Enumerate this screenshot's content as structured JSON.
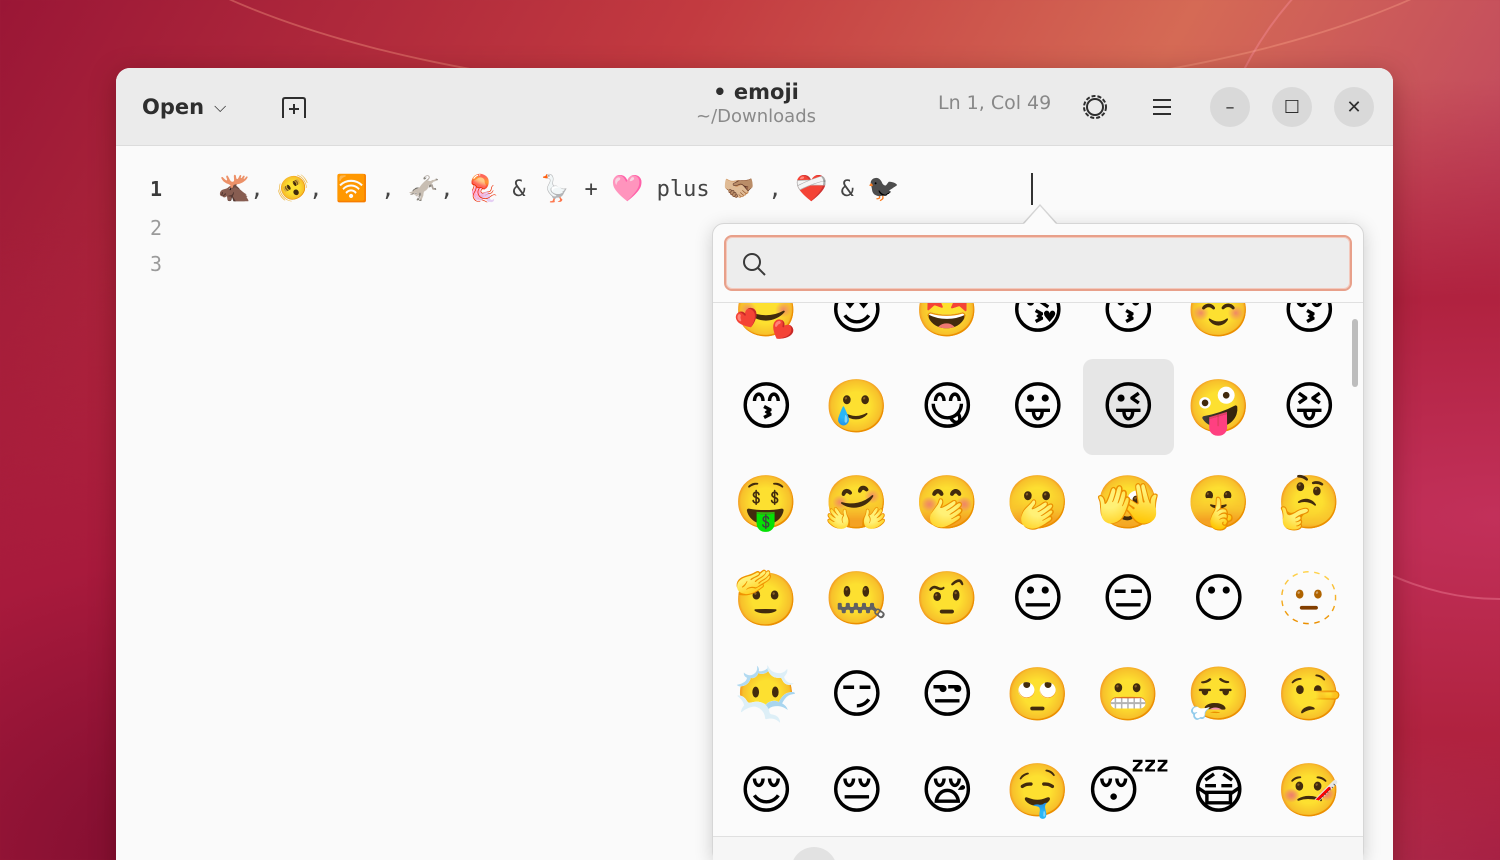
{
  "header": {
    "open_label": "Open",
    "chevron_glyph": "⌵",
    "title": "• emoji",
    "subtitle": "~/Downloads",
    "cursor_position": "Ln 1, Col 49",
    "minimize_glyph": "–",
    "maximize_glyph": "☐",
    "close_glyph": "✕"
  },
  "editor": {
    "line_numbers": [
      "1",
      "2",
      "3"
    ],
    "line1_segments": [
      {
        "text": "🫎",
        "emoji": true
      },
      {
        "text": ", ",
        "emoji": false
      },
      {
        "text": "🫨",
        "emoji": true
      },
      {
        "text": ", ",
        "emoji": false
      },
      {
        "text": "🛜",
        "emoji": true
      },
      {
        "text": " , ",
        "emoji": false
      },
      {
        "text": "🫏",
        "emoji": true
      },
      {
        "text": ", ",
        "emoji": false
      },
      {
        "text": "🪼",
        "emoji": true
      },
      {
        "text": " & ",
        "emoji": false
      },
      {
        "text": "🪿",
        "emoji": true
      },
      {
        "text": " + ",
        "emoji": false
      },
      {
        "text": "🩷",
        "emoji": true
      },
      {
        "text": " plus ",
        "emoji": false
      },
      {
        "text": "🫱🏼‍🫲🏽",
        "emoji": true
      },
      {
        "text": " , ",
        "emoji": false
      },
      {
        "text": "❤️‍🩹",
        "emoji": true
      },
      {
        "text": " & ",
        "emoji": false
      },
      {
        "text": "🐦‍⬛",
        "emoji": true
      }
    ]
  },
  "emoji_picker": {
    "search_placeholder": "",
    "search_value": "",
    "rows": [
      [
        "🥰",
        "😍",
        "🤩",
        "😘",
        "😗",
        "☺️",
        "😚"
      ],
      [
        "😙",
        "🥲",
        "😋",
        "😛",
        "😜",
        "🤪",
        "😝"
      ],
      [
        "🤑",
        "🤗",
        "🤭",
        "🫢",
        "🫣",
        "🤫",
        "🤔"
      ],
      [
        "🫡",
        "🤐",
        "🤨",
        "😐",
        "😑",
        "😶",
        "🫥"
      ],
      [
        "😶‍🌫️",
        "😏",
        "😒",
        "🙄",
        "😬",
        "😮‍💨",
        "🤥"
      ],
      [
        "😌",
        "😔",
        "😪",
        "🤤",
        "😴",
        "😷",
        "🤒"
      ]
    ],
    "hovered": "😜"
  }
}
